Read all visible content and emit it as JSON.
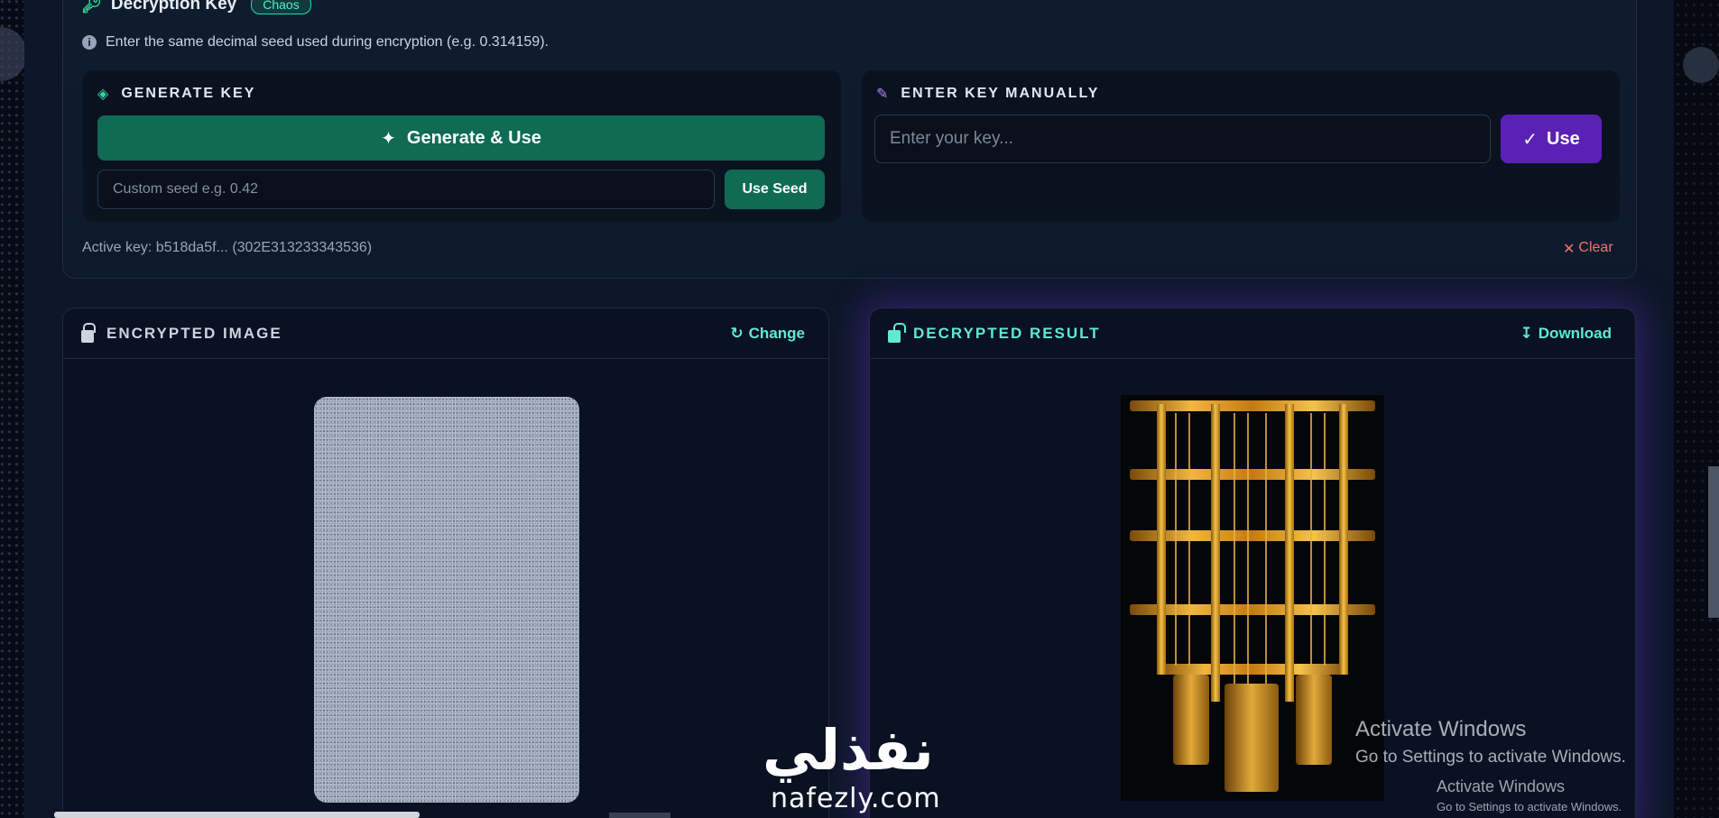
{
  "decryption": {
    "title": "Decryption Key",
    "badge": "Chaos",
    "info": "Enter the same decimal seed used during encryption (e.g. 0.314159)."
  },
  "generate": {
    "label": "GENERATE KEY",
    "button": "Generate & Use",
    "seed_placeholder": "Custom seed e.g. 0.42",
    "seed_button": "Use Seed"
  },
  "manual": {
    "label": "ENTER KEY MANUALLY",
    "placeholder": "Enter your key...",
    "button": "Use"
  },
  "status": {
    "active_key": "Active key: b518da5f... (302E313233343536)",
    "clear": "Clear"
  },
  "encrypted": {
    "title": "ENCRYPTED IMAGE",
    "action": "Change"
  },
  "decrypted": {
    "title": "DECRYPTED RESULT",
    "action": "Download"
  },
  "watermark": {
    "logo": "نفذلي",
    "site": "nafezly.com"
  },
  "windows": {
    "title": "Activate Windows",
    "subtitle": "Go to Settings to activate Windows.",
    "title2": "Activate Windows",
    "subtitle2": "Go to Settings to activate Windows."
  },
  "icons": {
    "key": "key-icon",
    "info": "info-icon",
    "dice": "dice-icon",
    "pencil": "pencil-icon",
    "wand": "magic-wand-icon",
    "check": "check-icon",
    "lock": "lock-icon",
    "unlock": "unlock-icon",
    "refresh": "refresh-icon",
    "download": "download-icon",
    "close": "close-icon"
  },
  "colors": {
    "accent_green": "#0f6b54",
    "accent_purple": "#5b21b6",
    "teal_text": "#5eead4",
    "danger": "#f87171"
  }
}
